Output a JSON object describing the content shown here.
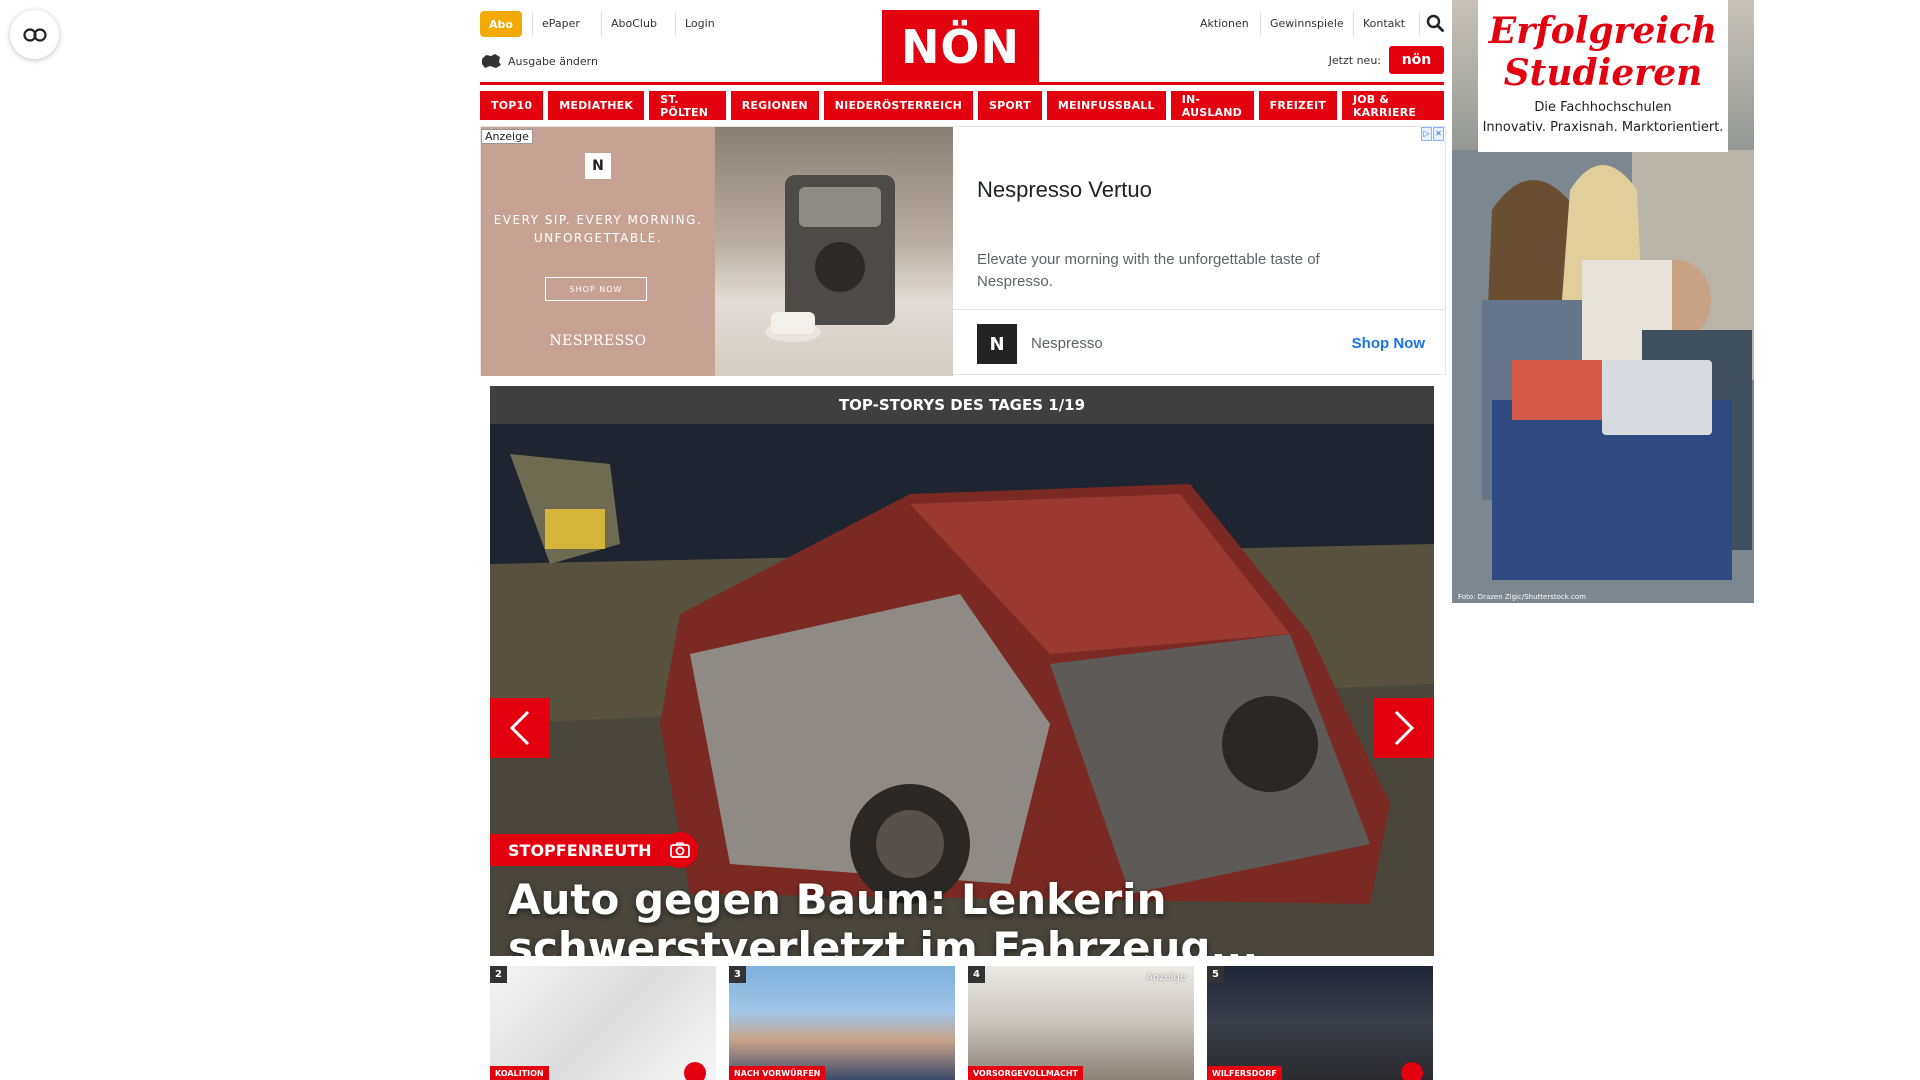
{
  "header": {
    "abo_label": "Abo",
    "links_left": [
      "ePaper",
      "AboClub",
      "Login"
    ],
    "logo_text": "NÖN",
    "links_right": [
      "Aktionen",
      "Gewinnspiele",
      "Kontakt"
    ],
    "edition_label": "Ausgabe ändern",
    "jetzt_label": "Jetzt neu:",
    "tv_badge_text": "nön"
  },
  "nav": [
    "TOP10",
    "MEDIATHEK",
    "ST. PÖLTEN",
    "REGIONEN",
    "NIEDERÖSTERREICH",
    "SPORT",
    "MEINFUSSBALL",
    "IN-AUSLAND",
    "FREIZEIT",
    "JOB & KARRIERE"
  ],
  "ad": {
    "tag": "Anzeige",
    "slogan": "EVERY SIP. EVERY MORNING. UNFORGETTABLE.",
    "shop_button": "SHOP NOW",
    "brand": "NESPRESSO",
    "headline": "Nespresso Vertuo",
    "description": "Elevate your morning with the unforgettable taste of Nespresso.",
    "advertiser": "Nespresso",
    "cta": "Shop Now"
  },
  "topstory": {
    "bar_title": "TOP-STORYS DES TAGES 1/19",
    "kicker": "STOPFENREUTH",
    "title": "Auto gegen Baum: Lenkerin schwerstverletzt im Fahrzeug..."
  },
  "thumbs": [
    {
      "num": "2",
      "kicker": "KOALITION",
      "anzeige": ""
    },
    {
      "num": "3",
      "kicker": "NACH VORWÜRFEN",
      "anzeige": ""
    },
    {
      "num": "4",
      "kicker": "VORSORGEVOLLMACHT",
      "anzeige": "Anzeige"
    },
    {
      "num": "5",
      "kicker": "WILFERSDORF",
      "anzeige": ""
    }
  ],
  "sidead": {
    "headline": "Erfolgreich Studieren",
    "sub1": "Die Fachhochschulen",
    "sub2": "Innovativ. Praxisnah. Marktorientiert.",
    "credit": "Foto: Drazen Zigic/Shutterstock.com"
  },
  "colors": {
    "brand_red": "#e3000f",
    "abo_orange": "#f2a900",
    "story_bar": "#3f3f3f",
    "ad_link_blue": "#1a73e8"
  },
  "icons": [
    "reader-mode-icon",
    "map-icon",
    "search-icon",
    "chevron-left-icon",
    "chevron-right-icon",
    "camera-icon",
    "adchoices-icon"
  ]
}
